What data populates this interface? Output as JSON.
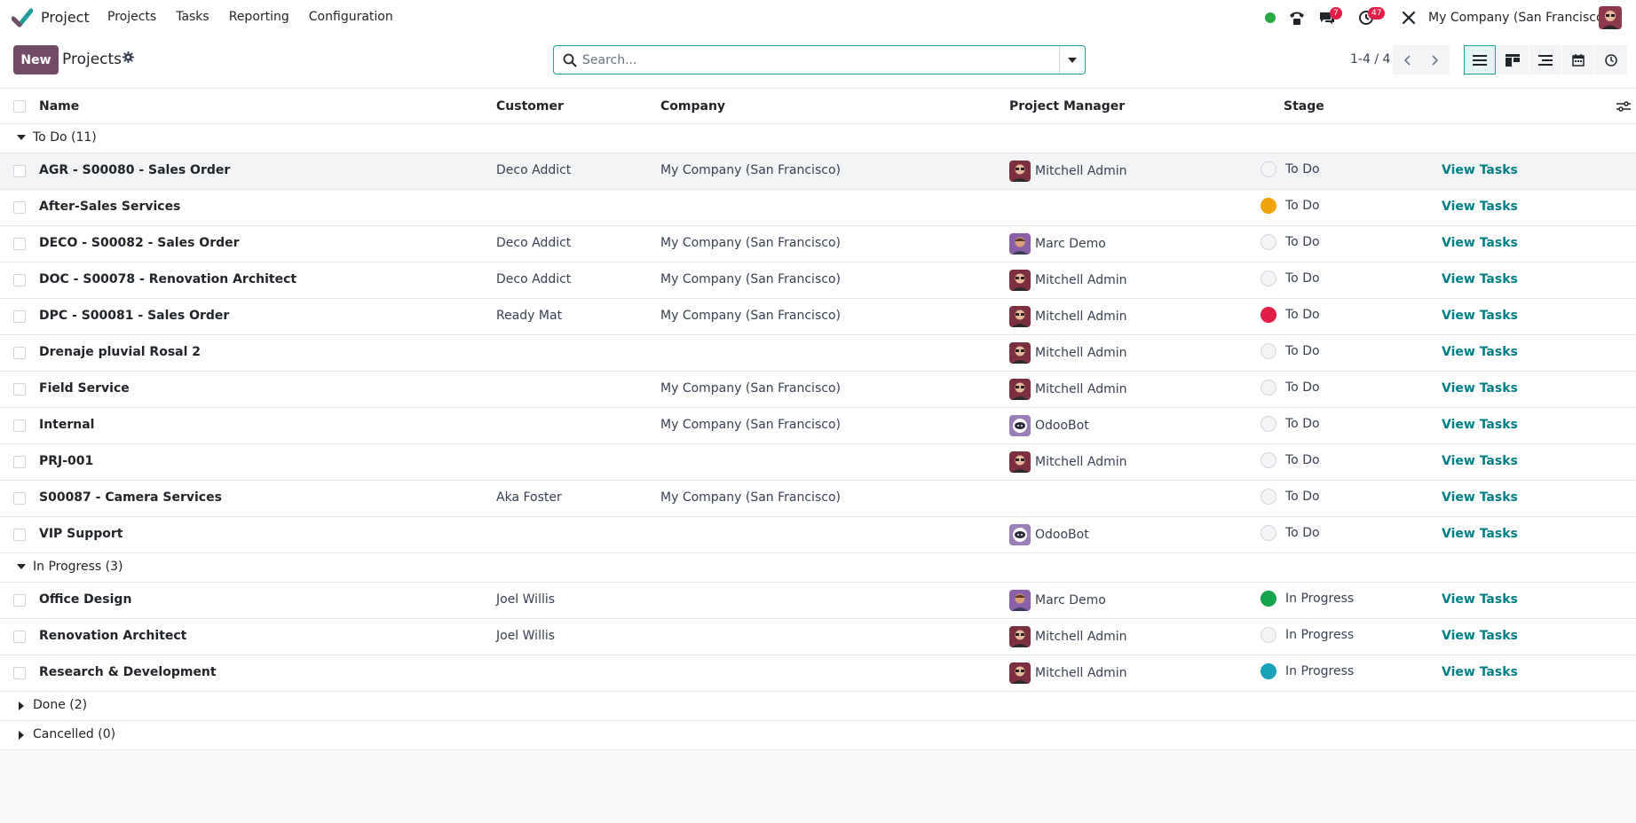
{
  "app": {
    "name": "Project"
  },
  "menu": [
    "Projects",
    "Tasks",
    "Reporting",
    "Configuration"
  ],
  "systray": {
    "status_color": "#28a745",
    "messages_count": "7",
    "activities_count": "47",
    "company": "My Company (San Francisco)"
  },
  "control": {
    "new_label": "New",
    "breadcrumb": "Projects",
    "search_placeholder": "Search...",
    "pager": "1-4 / 4"
  },
  "columns": {
    "name": "Name",
    "customer": "Customer",
    "company": "Company",
    "manager": "Project Manager",
    "stage": "Stage"
  },
  "groups": [
    {
      "label": "To Do (11)",
      "expanded": true
    },
    {
      "label": "In Progress (3)",
      "expanded": true
    },
    {
      "label": "Done (2)",
      "expanded": false
    },
    {
      "label": "Cancelled (0)",
      "expanded": false
    }
  ],
  "action_label": "View Tasks",
  "rows_todo": [
    {
      "name": "AGR - S00080 - Sales Order",
      "customer": "Deco Addict",
      "company": "My Company (San Francisco)",
      "manager": "Mitchell Admin",
      "stage": "To Do",
      "color": "#f3f4f6"
    },
    {
      "name": "After-Sales Services",
      "customer": "",
      "company": "",
      "manager": "",
      "stage": "To Do",
      "color": "#f0a30a"
    },
    {
      "name": "DECO - S00082 - Sales Order",
      "customer": "Deco Addict",
      "company": "My Company (San Francisco)",
      "manager": "Marc Demo",
      "stage": "To Do",
      "color": "#f3f4f6"
    },
    {
      "name": "DOC - S00078 - Renovation Architect",
      "customer": "Deco Addict",
      "company": "My Company (San Francisco)",
      "manager": "Mitchell Admin",
      "stage": "To Do",
      "color": "#f3f4f6"
    },
    {
      "name": "DPC - S00081 - Sales Order",
      "customer": "Ready Mat",
      "company": "My Company (San Francisco)",
      "manager": "Mitchell Admin",
      "stage": "To Do",
      "color": "#e11d48"
    },
    {
      "name": "Drenaje pluvial Rosal 2",
      "customer": "",
      "company": "",
      "manager": "Mitchell Admin",
      "stage": "To Do",
      "color": "#f3f4f6"
    },
    {
      "name": "Field Service",
      "customer": "",
      "company": "My Company (San Francisco)",
      "manager": "Mitchell Admin",
      "stage": "To Do",
      "color": "#f3f4f6"
    },
    {
      "name": "Internal",
      "customer": "",
      "company": "My Company (San Francisco)",
      "manager": "OdooBot",
      "stage": "To Do",
      "color": "#f3f4f6"
    },
    {
      "name": "PRJ-001",
      "customer": "",
      "company": "",
      "manager": "Mitchell Admin",
      "stage": "To Do",
      "color": "#f3f4f6"
    },
    {
      "name": "S00087 - Camera Services",
      "customer": "Aka Foster",
      "company": "My Company (San Francisco)",
      "manager": "",
      "stage": "To Do",
      "color": "#f3f4f6"
    },
    {
      "name": "VIP Support",
      "customer": "",
      "company": "",
      "manager": "OdooBot",
      "stage": "To Do",
      "color": "#f3f4f6"
    }
  ],
  "rows_progress": [
    {
      "name": "Office Design",
      "customer": "Joel Willis",
      "company": "",
      "manager": "Marc Demo",
      "stage": "In Progress",
      "color": "#16a34a"
    },
    {
      "name": "Renovation Architect",
      "customer": "Joel Willis",
      "company": "",
      "manager": "Mitchell Admin",
      "stage": "In Progress",
      "color": "#f3f4f6"
    },
    {
      "name": "Research & Development",
      "customer": "",
      "company": "",
      "manager": "Mitchell Admin",
      "stage": "In Progress",
      "color": "#17a2b8"
    }
  ]
}
